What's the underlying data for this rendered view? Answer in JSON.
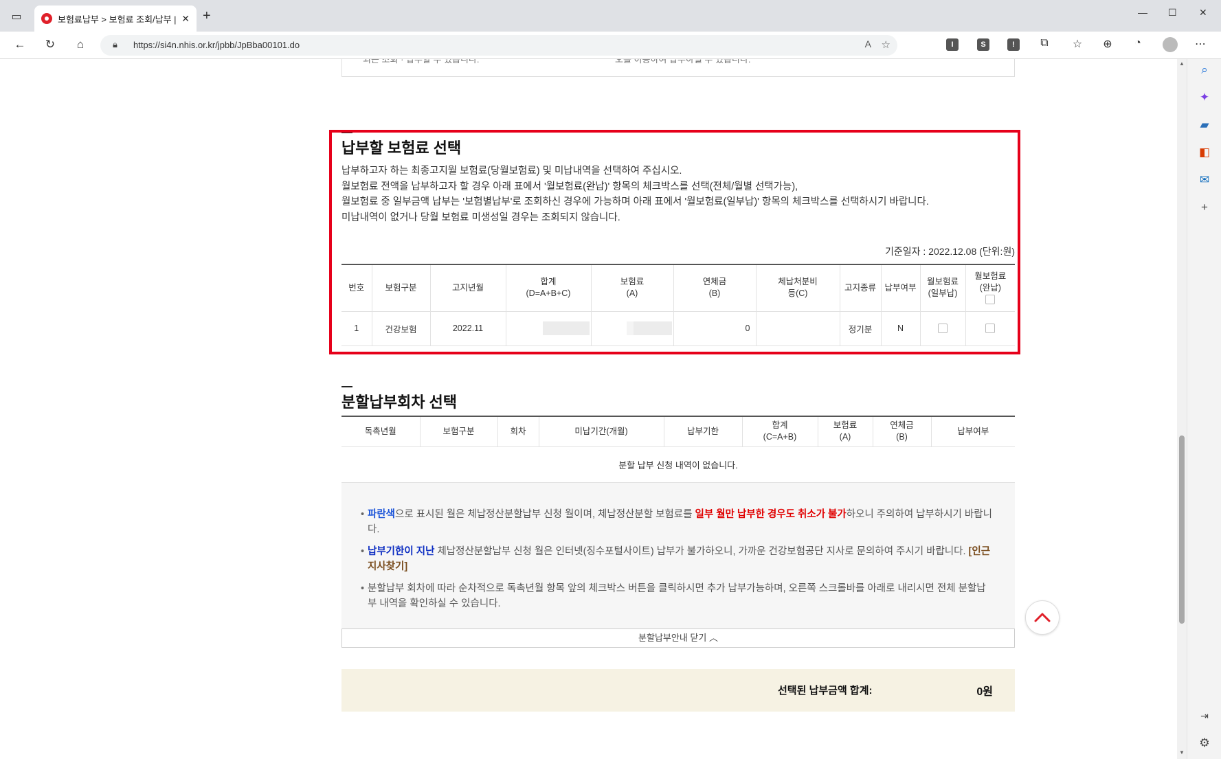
{
  "browser": {
    "tab_title": "보험료납부 > 보험료 조회/납부 |",
    "url": "https://si4n.nhis.or.kr/jpbb/JpBba00101.do"
  },
  "prev_section": {
    "left_text": "되는 조회 · 납부할 수 있습니다.",
    "right_text": "오를 이용하여 납부하실 수 있습니다."
  },
  "premium_section": {
    "title": "납부할 보험료 선택",
    "desc": [
      "납부하고자 하는 최종고지월 보험료(당월보험료) 및 미납내역을 선택하여 주십시오.",
      "월보험료 전액을 납부하고자 할 경우 아래 표에서 '월보험료(완납)' 항목의 체크박스를 선택(전체/월별 선택가능),",
      "월보험료 중 일부금액 납부는 '보험별납부'로 조회하신 경우에 가능하며 아래 표에서 '월보험료(일부납)' 항목의 체크박스를 선택하시기 바랍니다.",
      "미납내역이 없거나 당월 보험료 미생성일 경우는 조회되지 않습니다."
    ],
    "base_date": "기준일자 : 2022.12.08 (단위:원)",
    "headers": {
      "no": "번호",
      "type": "보험구분",
      "month": "고지년월",
      "total": "합계",
      "total_sub": "(D=A+B+C)",
      "premium": "보험료",
      "premium_sub": "(A)",
      "late": "연체금",
      "late_sub": "(B)",
      "disp1": "체납처분비",
      "disp2": "등(C)",
      "kind": "고지종류",
      "paid": "납부여부",
      "part1": "월보험료",
      "part2": "(일부납)",
      "full1": "월보험료",
      "full2": "(완납)"
    },
    "row": {
      "no": "1",
      "type": "건강보험",
      "month": "2022.11",
      "late": "0",
      "kind": "정기분",
      "paid": "N"
    }
  },
  "installment_section": {
    "title": "분할납부회차 선택",
    "headers": {
      "month": "독촉년월",
      "type": "보험구분",
      "round": "회차",
      "period": "미납기간(개월)",
      "deadline": "납부기한",
      "total": "합계",
      "total_sub": "(C=A+B)",
      "premium": "보험료",
      "premium_sub": "(A)",
      "late": "연체금",
      "late_sub": "(B)",
      "paid": "납부여부"
    },
    "empty": "분할 납부 신청 내역이 없습니다."
  },
  "info": {
    "b1_blue": "파란색",
    "b1_a": "으로 표시된 월은 체납정산분할납부 신청 월이며, 체납정산분할 보험료를 ",
    "b1_red": "일부 월만 납부한 경우도 취소가 불가",
    "b1_b": "하오니 주의하여 납부하시기 바랍니다.",
    "b2_navy": "납부기한이 지난",
    "b2_a": " 체납정산분할납부 신청 월은 인터넷(징수포털사이트) 납부가 불가하오니, 가까운 건강보험공단 지사로 문의하여 주시기 바랍니다. ",
    "b2_link": "[인근지사찾기]",
    "b3": "분할납부 회차에 따라 순차적으로 독촉년월 항목 앞의 체크박스 버튼을 클릭하시면 추가 납부가능하며, 오른쪽 스크롤바를 아래로 내리시면 전체 분할납부 내역을 확인하실 수 있습니다."
  },
  "close_guide": "분할납부안내 닫기 ︿",
  "total": {
    "label": "선택된 납부금액 합계:",
    "value": "0원"
  },
  "colors": {
    "highlight": "#e6001a",
    "blue_text": "#1a53d8",
    "red_text": "#e00000",
    "total_bg": "#f6f2e3"
  }
}
